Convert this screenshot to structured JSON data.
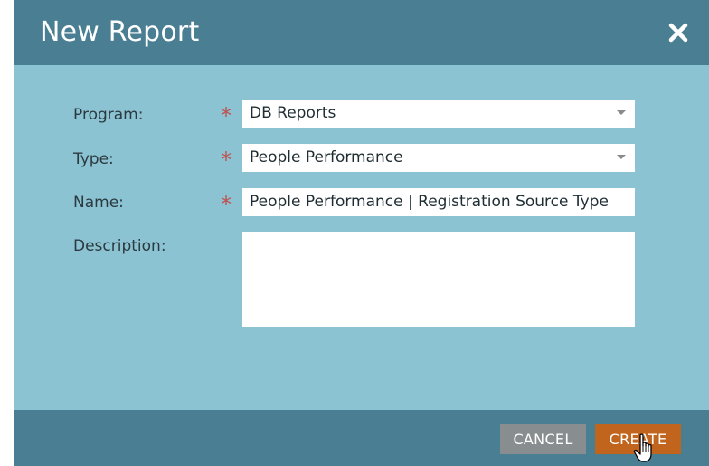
{
  "dialog": {
    "title": "New Report",
    "close_icon": "close-icon"
  },
  "form": {
    "program": {
      "label": "Program:",
      "required": "*",
      "value": "DB Reports"
    },
    "type": {
      "label": "Type:",
      "required": "*",
      "value": "People Performance"
    },
    "name": {
      "label": "Name:",
      "required": "*",
      "value": "People Performance | Registration Source Type"
    },
    "description": {
      "label": "Description:",
      "value": ""
    }
  },
  "footer": {
    "cancel_label": "CANCEL",
    "create_label": "CREATE"
  },
  "colors": {
    "header_bg": "#4a7f93",
    "body_bg": "#8cc3d2",
    "cancel_bg": "#888e90",
    "create_bg": "#c0641e",
    "required_star": "#c0504d"
  }
}
